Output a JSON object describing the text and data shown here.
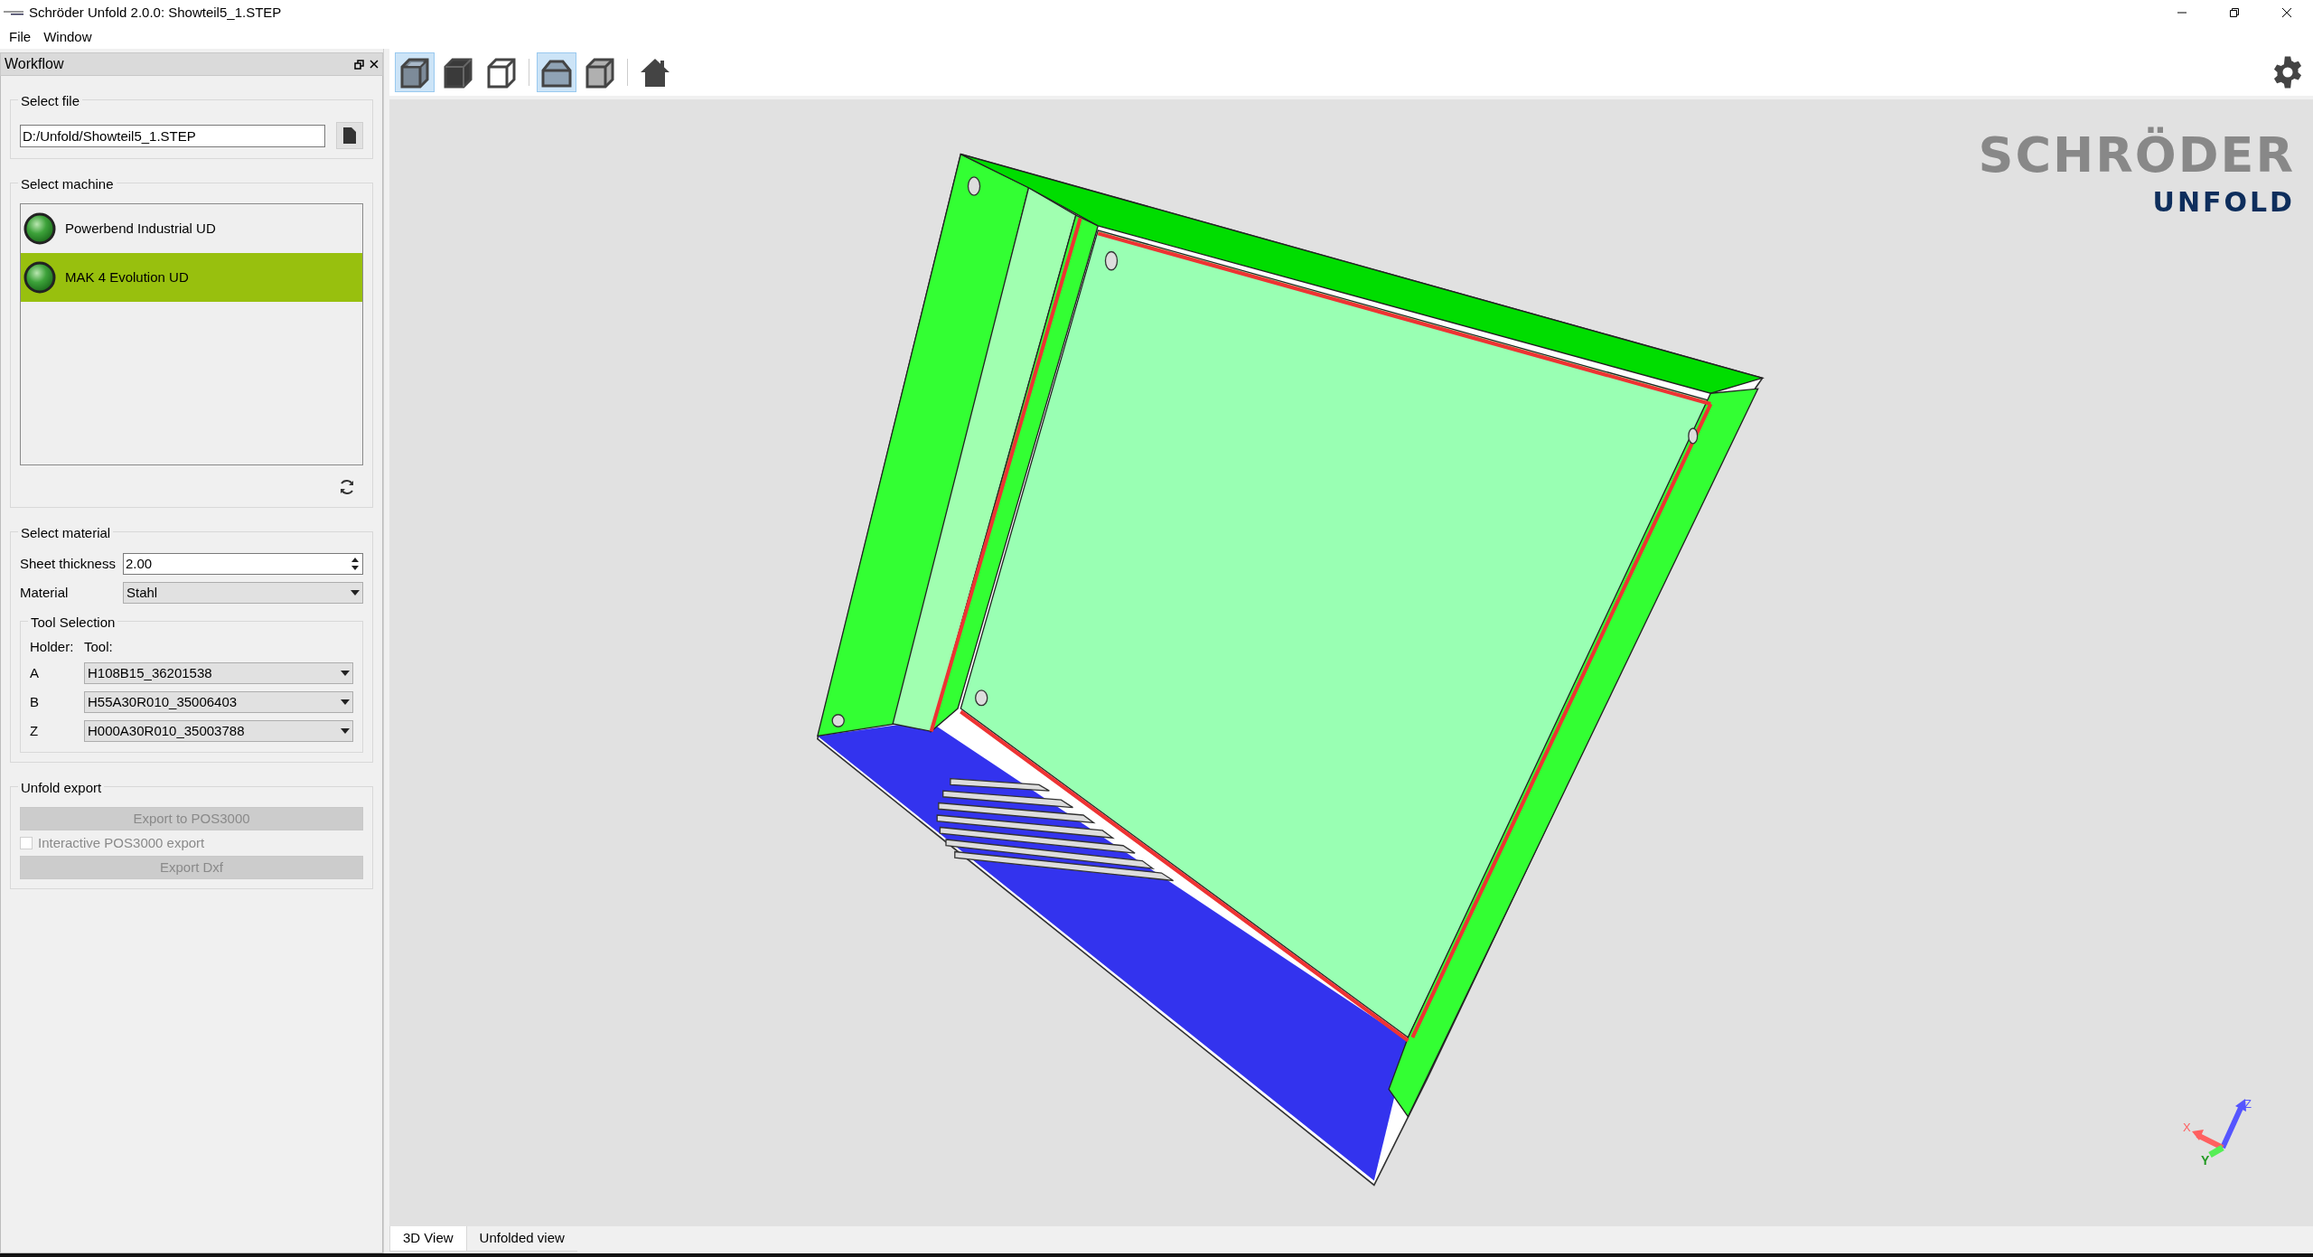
{
  "window": {
    "title": "Schröder Unfold 2.0.0: Showteil5_1.STEP"
  },
  "menu": [
    "File",
    "Window"
  ],
  "dock": {
    "title": "Workflow",
    "select_file": {
      "title": "Select file",
      "path": "D:/Unfold/Showteil5_1.STEP"
    },
    "select_machine": {
      "title": "Select machine",
      "machines": [
        {
          "name": "Powerbend Industrial UD",
          "selected": false
        },
        {
          "name": "MAK 4 Evolution UD",
          "selected": true
        }
      ]
    },
    "select_material": {
      "title": "Select material",
      "sheet_thickness_label": "Sheet thickness",
      "sheet_thickness": "2.00",
      "material_label": "Material",
      "material": "Stahl",
      "tool_selection": {
        "title": "Tool Selection",
        "holder_header": "Holder:",
        "tool_header": "Tool:",
        "rows": [
          {
            "holder": "A",
            "tool": "H108B15_36201538"
          },
          {
            "holder": "B",
            "tool": "H55A30R010_35006403"
          },
          {
            "holder": "Z",
            "tool": "H000A30R010_35003788"
          }
        ]
      }
    },
    "unfold_export": {
      "title": "Unfold export",
      "export_pos_button": {
        "label": "Export to POS3000",
        "disabled": true
      },
      "interactive_checkbox": {
        "label": "Interactive POS3000 export",
        "checked": false,
        "disabled": true
      },
      "export_dxf_button": {
        "label": "Export Dxf",
        "disabled": true
      }
    }
  },
  "toolbar": {
    "groups": [
      {
        "buttons": [
          {
            "kind": "box-transparent",
            "selected": true
          },
          {
            "kind": "box-solid",
            "selected": false
          },
          {
            "kind": "box-wire",
            "selected": false
          }
        ]
      },
      {
        "buttons": [
          {
            "kind": "front-shape",
            "selected": true
          },
          {
            "kind": "box-gray",
            "selected": false
          }
        ]
      },
      {
        "buttons": [
          {
            "kind": "home",
            "selected": false
          }
        ]
      }
    ]
  },
  "logo": {
    "top": "SCHRÖDER",
    "bottom": "UNFOLD"
  },
  "axes": {
    "x": "X",
    "y": "Y",
    "z": "Z"
  },
  "view_tabs": [
    {
      "label": "3D View",
      "selected": true
    },
    {
      "label": "Unfolded view",
      "selected": false
    }
  ]
}
